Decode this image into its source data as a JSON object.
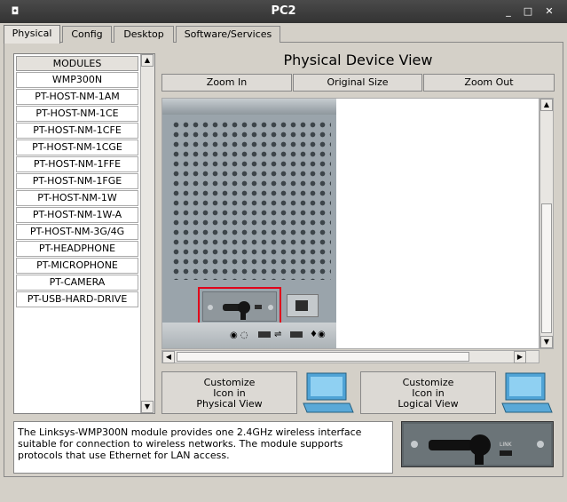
{
  "window": {
    "title": "PC2",
    "menu_icon": "window-menu-icon",
    "minimize": "_",
    "maximize": "□",
    "close": "✕"
  },
  "tabs": [
    {
      "label": "Physical",
      "active": true
    },
    {
      "label": "Config",
      "active": false
    },
    {
      "label": "Desktop",
      "active": false
    },
    {
      "label": "Software/Services",
      "active": false
    }
  ],
  "modules": {
    "header": "MODULES",
    "items": [
      "WMP300N",
      "PT-HOST-NM-1AM",
      "PT-HOST-NM-1CE",
      "PT-HOST-NM-1CFE",
      "PT-HOST-NM-1CGE",
      "PT-HOST-NM-1FFE",
      "PT-HOST-NM-1FGE",
      "PT-HOST-NM-1W",
      "PT-HOST-NM-1W-A",
      "PT-HOST-NM-3G/4G",
      "PT-HEADPHONE",
      "PT-MICROPHONE",
      "PT-CAMERA",
      "PT-USB-HARD-DRIVE"
    ]
  },
  "device_view": {
    "title": "Physical Device View",
    "zoom_in": "Zoom In",
    "original_size": "Original Size",
    "zoom_out": "Zoom Out"
  },
  "customize": {
    "physical": "Customize\nIcon in\nPhysical View",
    "logical": "Customize\nIcon in\nLogical View"
  },
  "description": "The Linksys-WMP300N module provides one 2.4GHz wireless interface suitable for connection to wireless networks. The module supports protocols that use Ethernet for LAN access.",
  "module_image": {
    "label": "LINK"
  },
  "colors": {
    "title_bar": "#3a3a3a",
    "panel": "#d4d0c8",
    "highlight": "#e0001a",
    "monitor": "#4fa3d6"
  }
}
